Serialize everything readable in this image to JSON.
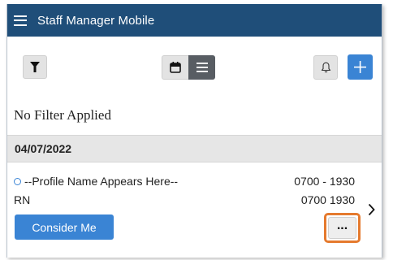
{
  "app": {
    "title": "Staff Manager Mobile"
  },
  "toolbar": {
    "filter_icon": "filter-icon",
    "calendar_view_icon": "calendar-icon",
    "list_view_icon": "list-icon",
    "list_view_active": true,
    "bell_icon": "bell-icon",
    "add_icon": "plus-icon"
  },
  "filter": {
    "status_text": "No Filter Applied"
  },
  "schedule": {
    "date": "04/07/2022",
    "shifts": [
      {
        "profile_name": "--Profile Name Appears Here--",
        "time_range": "0700 - 1930",
        "role": "RN",
        "time_plain": "0700 1930",
        "action_label": "Consider Me",
        "more_label": "..."
      }
    ]
  },
  "colors": {
    "header_bg": "#1f4e79",
    "primary_blue": "#3a84d4",
    "highlight_orange": "#e57a2e",
    "active_segment": "#585d63"
  }
}
